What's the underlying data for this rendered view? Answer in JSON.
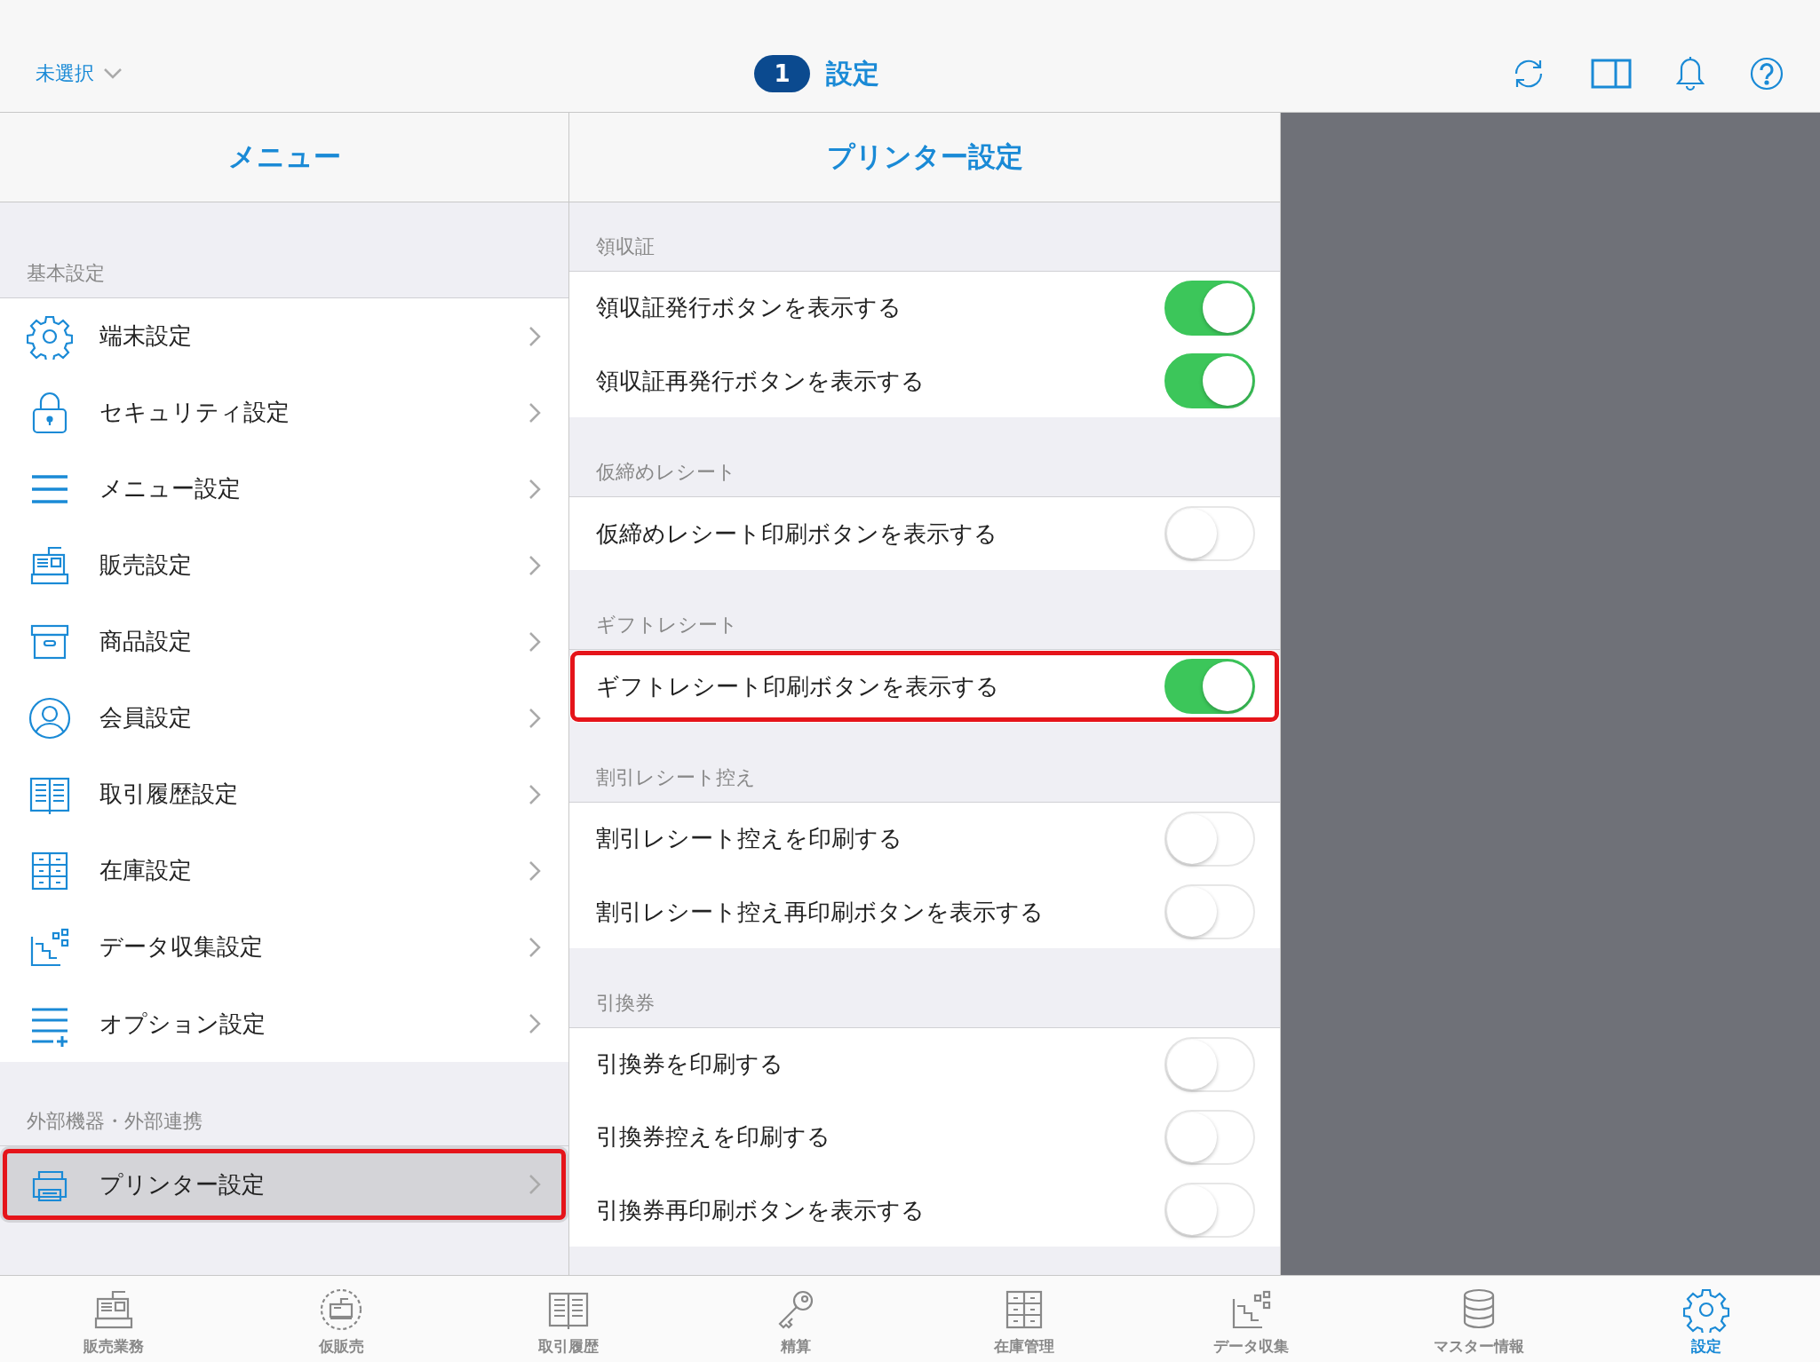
{
  "top_bar": {
    "store_selector": "未選択",
    "badge": "1",
    "title": "設定"
  },
  "menu": {
    "title": "メニュー",
    "sections": [
      {
        "title": "基本設定",
        "items": [
          {
            "label": "端末設定",
            "selected": false,
            "highlighted": false
          },
          {
            "label": "セキュリティ設定",
            "selected": false,
            "highlighted": false
          },
          {
            "label": "メニュー設定",
            "selected": false,
            "highlighted": false
          },
          {
            "label": "販売設定",
            "selected": false,
            "highlighted": false
          },
          {
            "label": "商品設定",
            "selected": false,
            "highlighted": false
          },
          {
            "label": "会員設定",
            "selected": false,
            "highlighted": false
          },
          {
            "label": "取引履歴設定",
            "selected": false,
            "highlighted": false
          },
          {
            "label": "在庫設定",
            "selected": false,
            "highlighted": false
          },
          {
            "label": "データ収集設定",
            "selected": false,
            "highlighted": false
          },
          {
            "label": "オプション設定",
            "selected": false,
            "highlighted": false
          }
        ]
      },
      {
        "title": "外部機器・外部連携",
        "items": [
          {
            "label": "プリンター設定",
            "selected": true,
            "highlighted": true
          }
        ]
      }
    ]
  },
  "detail": {
    "title": "プリンター設定",
    "sections": [
      {
        "title": "領収証",
        "rows": [
          {
            "label": "領収証発行ボタンを表示する",
            "on": true,
            "highlighted": false
          },
          {
            "label": "領収証再発行ボタンを表示する",
            "on": true,
            "highlighted": false
          }
        ]
      },
      {
        "title": "仮締めレシート",
        "rows": [
          {
            "label": "仮締めレシート印刷ボタンを表示する",
            "on": false,
            "highlighted": false
          }
        ]
      },
      {
        "title": "ギフトレシート",
        "rows": [
          {
            "label": "ギフトレシート印刷ボタンを表示する",
            "on": true,
            "highlighted": true
          }
        ]
      },
      {
        "title": "割引レシート控え",
        "rows": [
          {
            "label": "割引レシート控えを印刷する",
            "on": false,
            "highlighted": false
          },
          {
            "label": "割引レシート控え再印刷ボタンを表示する",
            "on": false,
            "highlighted": false
          }
        ]
      },
      {
        "title": "引換券",
        "rows": [
          {
            "label": "引換券を印刷する",
            "on": false,
            "highlighted": false
          },
          {
            "label": "引換券控えを印刷する",
            "on": false,
            "highlighted": false
          },
          {
            "label": "引換券再印刷ボタンを表示する",
            "on": false,
            "highlighted": false
          }
        ]
      }
    ]
  },
  "tab_bar": [
    {
      "label": "販売業務",
      "selected": false
    },
    {
      "label": "仮販売",
      "selected": false
    },
    {
      "label": "取引履歴",
      "selected": false
    },
    {
      "label": "精算",
      "selected": false
    },
    {
      "label": "在庫管理",
      "selected": false
    },
    {
      "label": "データ収集",
      "selected": false
    },
    {
      "label": "マスター情報",
      "selected": false
    },
    {
      "label": "設定",
      "selected": true
    }
  ]
}
